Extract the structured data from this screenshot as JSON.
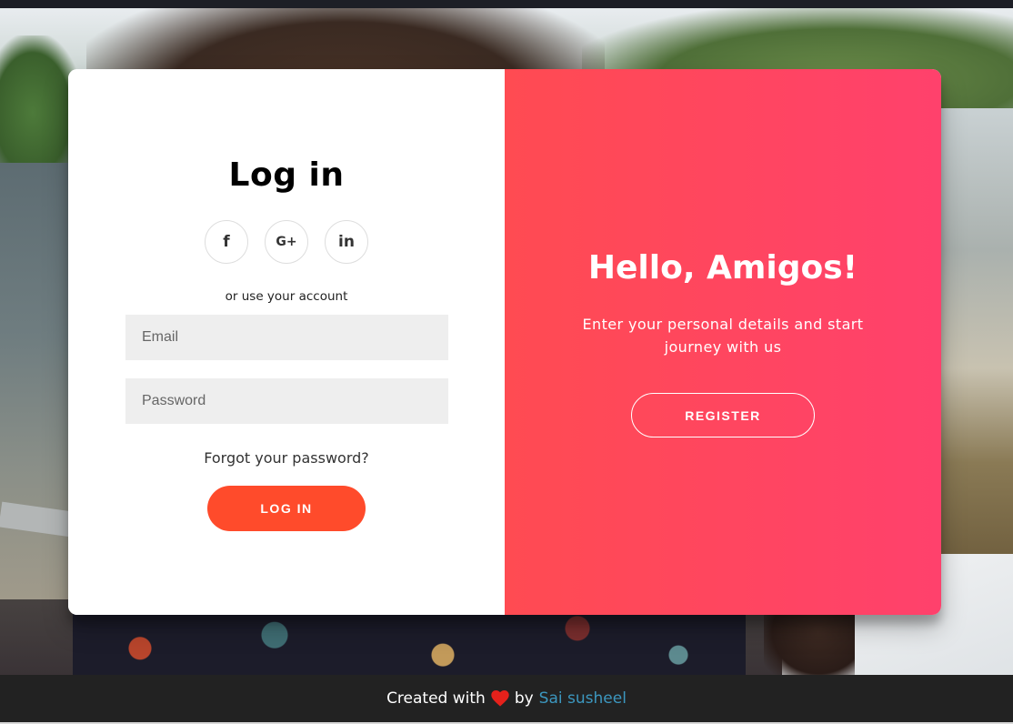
{
  "login": {
    "title": "Log in",
    "social": [
      {
        "name": "facebook",
        "glyph": "f"
      },
      {
        "name": "google-plus",
        "glyph": "G+"
      },
      {
        "name": "linkedin",
        "glyph": "in"
      }
    ],
    "or_text": "or use your account",
    "email_placeholder": "Email",
    "password_placeholder": "Password",
    "forgot_link": "Forgot your password?",
    "button_label": "LOG IN"
  },
  "overlay": {
    "title": "Hello, Amigos!",
    "text": "Enter your personal details and start journey with us",
    "button_label": "REGISTER"
  },
  "footer": {
    "prefix": "Created with",
    "icon": "heart-icon",
    "by": "by",
    "author": "Sai susheel"
  },
  "colors": {
    "accent": "#ff4b2b",
    "overlay_start": "#ff4b52",
    "overlay_end": "#ff416c",
    "heart": "#e5211b",
    "author_link": "#3c97bf",
    "footer_bg": "#222222"
  }
}
